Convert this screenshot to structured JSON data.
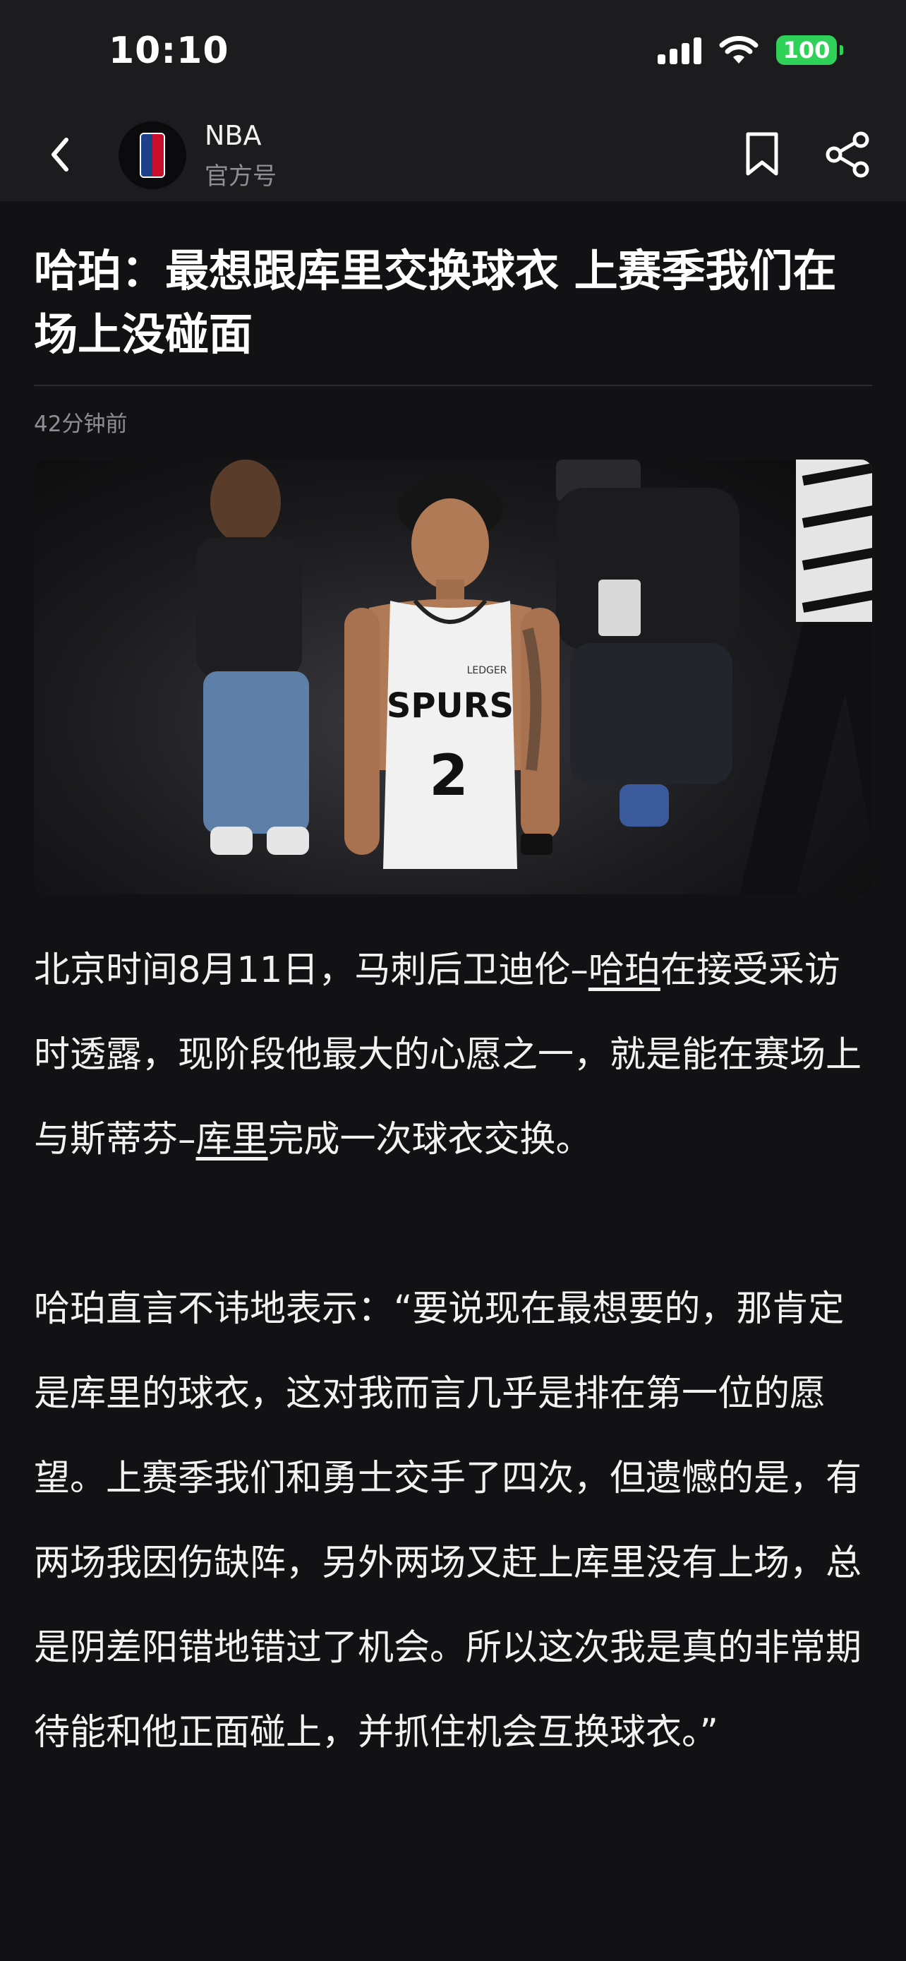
{
  "status_bar": {
    "time": "10:10",
    "battery": "100"
  },
  "header": {
    "account_name": "NBA",
    "account_subtitle": "官方号"
  },
  "article": {
    "headline": "哈珀：最想跟库里交换球衣  上赛季我们在场上没碰面",
    "timestamp": "42分钟前",
    "photo": {
      "jersey_text": "SPURS",
      "jersey_number": "2",
      "patch_text": "LEDGER"
    },
    "paragraph1": {
      "part1": "北京时间8月11日，马刺后卫迪伦–",
      "link1": "哈珀",
      "part2": "在接受采访时透露，现阶段他最大的心愿之一，就是能在赛场上与斯蒂芬–",
      "link2": "库里",
      "part3": "完成一次球衣交换。"
    },
    "paragraph2": "哈珀直言不讳地表示：“要说现在最想要的，那肯定是库里的球衣，这对我而言几乎是排在第一位的愿望。上赛季我们和勇士交手了四次，但遗憾的是，有两场我因伤缺阵，另外两场又赶上库里没有上场，总是阴差阳错地错过了机会。所以这次我是真的非常期待能和他正面碰上，并抓住机会互换球衣。”"
  },
  "colors": {
    "background": "#121215",
    "header": "#1c1c1f",
    "battery": "#30d158",
    "muted": "#8e8e93"
  },
  "icons": [
    "signal-icon",
    "wifi-icon",
    "battery-icon",
    "back-icon",
    "nba-logo-icon",
    "bookmark-icon",
    "share-icon"
  ]
}
